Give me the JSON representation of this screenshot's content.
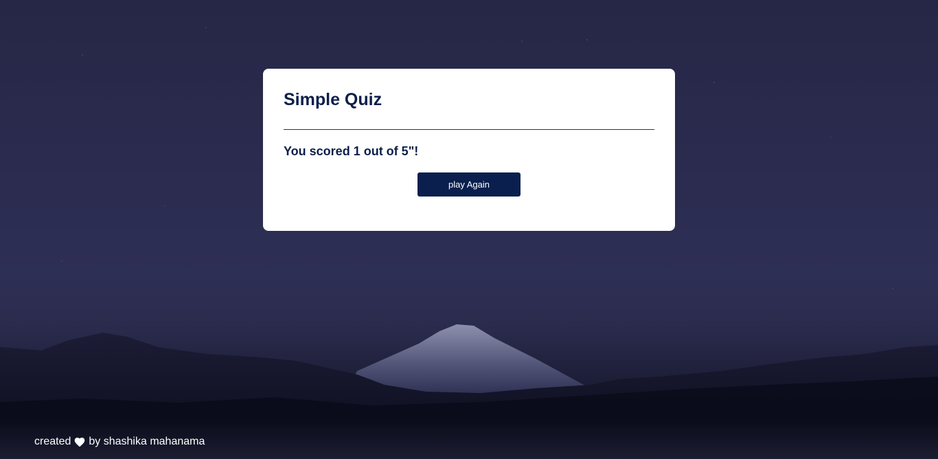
{
  "quiz": {
    "title": "Simple Quiz",
    "result_text": "You scored 1 out of 5\"!",
    "play_again_label": "play Again"
  },
  "footer": {
    "created_label": "created",
    "by_label": "by shashika mahanama",
    "heart_icon": "heart-icon"
  },
  "colors": {
    "brand_navy": "#0a1f4d",
    "card_bg": "#ffffff",
    "night_sky": "#2b2b4f"
  }
}
